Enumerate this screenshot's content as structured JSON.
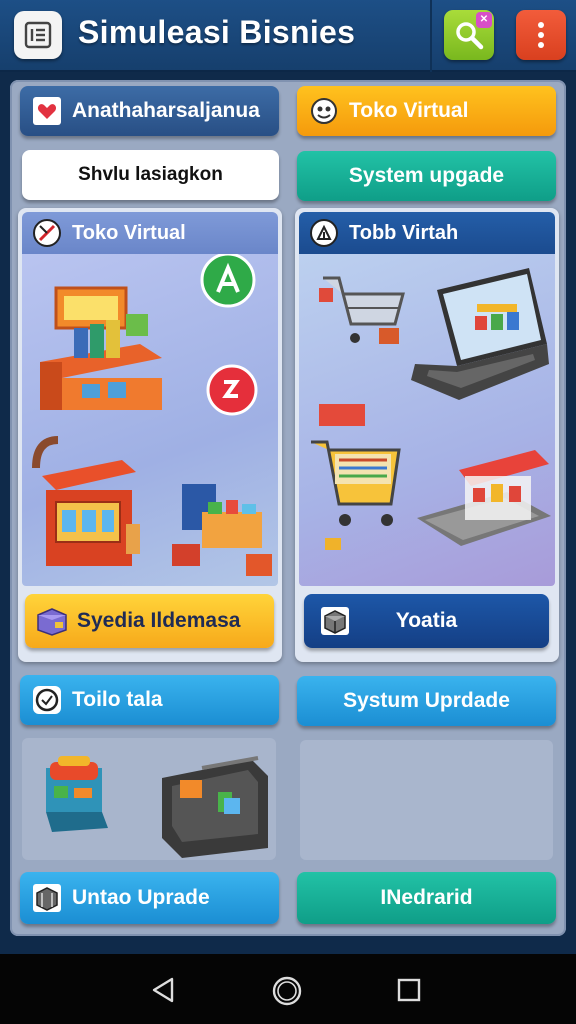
{
  "header": {
    "title": "Simuleasi Bisnies",
    "icons": {
      "menu": "menu-list-icon",
      "search": "search-icon",
      "more": "more-vertical-icon"
    },
    "colors": {
      "bar": "#1d4f86",
      "search": "#8cc629",
      "more": "#e84c2c"
    }
  },
  "top_buttons": {
    "left_1": "Anathaharsaljanua",
    "right_1": "Toko Virtual",
    "left_2": "Shvlu lasiagkon",
    "right_2": "System upgade"
  },
  "cards": {
    "left": {
      "title": "Toko Virtual",
      "footer_label": "Syedia Ildemasa"
    },
    "right": {
      "title": "Tobb Virtah",
      "footer_label": "Yoatia"
    }
  },
  "lower": {
    "left_header": "Toilo tala",
    "right_header": "Systum Uprdade",
    "left_footer": "Untao Uprade",
    "right_footer": "INedrarid"
  },
  "system_nav": {
    "icons": [
      "back-triangle-icon",
      "home-circle-icon",
      "recent-square-icon"
    ]
  }
}
